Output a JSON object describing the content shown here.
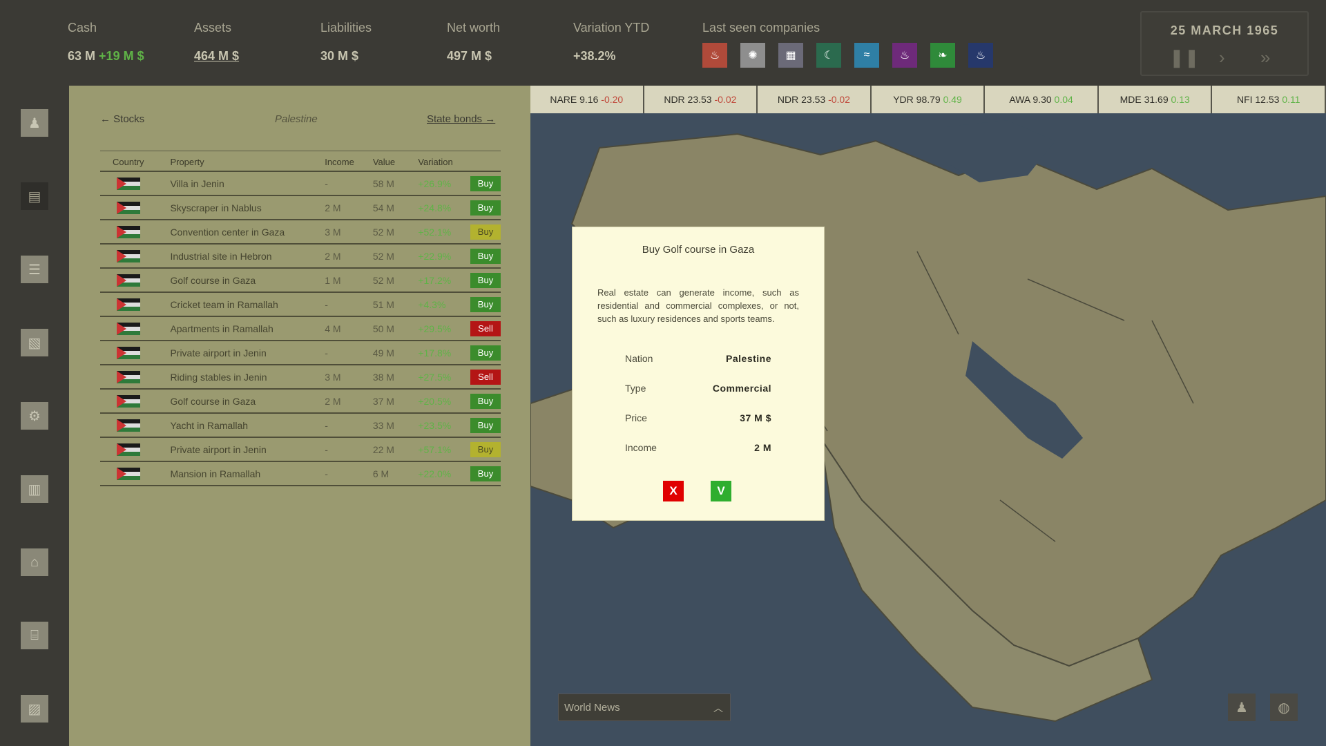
{
  "header": {
    "cash": {
      "label": "Cash",
      "value": "63 M",
      "delta": "+19 M $"
    },
    "assets": {
      "label": "Assets",
      "value": "464 M $"
    },
    "liabilities": {
      "label": "Liabilities",
      "value": "30 M $"
    },
    "net_worth": {
      "label": "Net worth",
      "value": "497 M $"
    },
    "variation": {
      "label": "Variation YTD",
      "value": "+38.2%"
    },
    "last_seen": {
      "label": "Last seen companies"
    },
    "companies": [
      {
        "icon": "oil-drop-icon",
        "glyph": "♨",
        "color": "#b04a3a"
      },
      {
        "icon": "sun-icon",
        "glyph": "✺",
        "color": "#8e8e8e"
      },
      {
        "icon": "grid-icon",
        "glyph": "▦",
        "color": "#6b6a78"
      },
      {
        "icon": "swirl-icon",
        "glyph": "☾",
        "color": "#2b6a4e"
      },
      {
        "icon": "wave-icon",
        "glyph": "≈",
        "color": "#2f7fa5"
      },
      {
        "icon": "flame-icon",
        "glyph": "♨",
        "color": "#6e2a7a"
      },
      {
        "icon": "leaf-icon",
        "glyph": "❧",
        "color": "#2f8a3a"
      },
      {
        "icon": "drop-icon",
        "glyph": "♨",
        "color": "#26386b"
      }
    ],
    "date": "25 MARCH 1965"
  },
  "panel": {
    "prev_link": "← Stocks",
    "country": "Palestine",
    "next_link": "State bonds →",
    "columns": [
      "Country",
      "Property",
      "Income",
      "Value",
      "Variation"
    ],
    "rows": [
      {
        "property": "Villa in Jenin",
        "income": "-",
        "value": "58 M",
        "variation": "+26.9%",
        "action": "Buy",
        "kind": "buy"
      },
      {
        "property": "Skyscraper in Nablus",
        "income": "2 M",
        "value": "54 M",
        "variation": "+24.8%",
        "action": "Buy",
        "kind": "buy"
      },
      {
        "property": "Convention center in Gaza",
        "income": "3 M",
        "value": "52 M",
        "variation": "+52.1%",
        "action": "Buy",
        "kind": "pending"
      },
      {
        "property": "Industrial site in Hebron",
        "income": "2 M",
        "value": "52 M",
        "variation": "+22.9%",
        "action": "Buy",
        "kind": "buy"
      },
      {
        "property": "Golf course in Gaza",
        "income": "1 M",
        "value": "52 M",
        "variation": "+17.2%",
        "action": "Buy",
        "kind": "buy"
      },
      {
        "property": "Cricket team in Ramallah",
        "income": "-",
        "value": "51 M",
        "variation": "+4.3%",
        "action": "Buy",
        "kind": "buy"
      },
      {
        "property": "Apartments in Ramallah",
        "income": "4 M",
        "value": "50 M",
        "variation": "+29.5%",
        "action": "Sell",
        "kind": "sell"
      },
      {
        "property": "Private airport in Jenin",
        "income": "-",
        "value": "49 M",
        "variation": "+17.8%",
        "action": "Buy",
        "kind": "buy"
      },
      {
        "property": "Riding stables in Jenin",
        "income": "3 M",
        "value": "38 M",
        "variation": "+27.5%",
        "action": "Sell",
        "kind": "sell"
      },
      {
        "property": "Golf course in Gaza",
        "income": "2 M",
        "value": "37 M",
        "variation": "+20.5%",
        "action": "Buy",
        "kind": "buy"
      },
      {
        "property": "Yacht in Ramallah",
        "income": "-",
        "value": "33 M",
        "variation": "+23.5%",
        "action": "Buy",
        "kind": "buy"
      },
      {
        "property": "Private airport in Jenin",
        "income": "-",
        "value": "22 M",
        "variation": "+57.1%",
        "action": "Buy",
        "kind": "pending"
      },
      {
        "property": "Mansion in Ramallah",
        "income": "-",
        "value": "6 M",
        "variation": "+22.0%",
        "action": "Buy",
        "kind": "buy"
      }
    ]
  },
  "ticker": [
    {
      "sym": "NARE 9.16",
      "chg": "-0.20",
      "dir": "down"
    },
    {
      "sym": "NDR 23.53",
      "chg": "-0.02",
      "dir": "down"
    },
    {
      "sym": "NDR 23.53",
      "chg": "-0.02",
      "dir": "down"
    },
    {
      "sym": "YDR 98.79",
      "chg": "0.49",
      "dir": "up"
    },
    {
      "sym": "AWA 9.30",
      "chg": "0.04",
      "dir": "up"
    },
    {
      "sym": "MDE 31.69",
      "chg": "0.13",
      "dir": "up"
    },
    {
      "sym": "NFI 12.53",
      "chg": "0.11",
      "dir": "up"
    }
  ],
  "dialog": {
    "title": "Buy Golf course in Gaza",
    "description": "Real estate can generate income, such as residential and commercial complexes, or not, such as luxury residences and sports teams.",
    "fields": [
      {
        "key": "Nation",
        "value": "Palestine"
      },
      {
        "key": "Type",
        "value": "Commercial"
      },
      {
        "key": "Price",
        "value": "37 M $"
      },
      {
        "key": "Income",
        "value": "2 M"
      }
    ],
    "cancel": "X",
    "confirm": "V"
  },
  "news": {
    "label": "World News"
  }
}
